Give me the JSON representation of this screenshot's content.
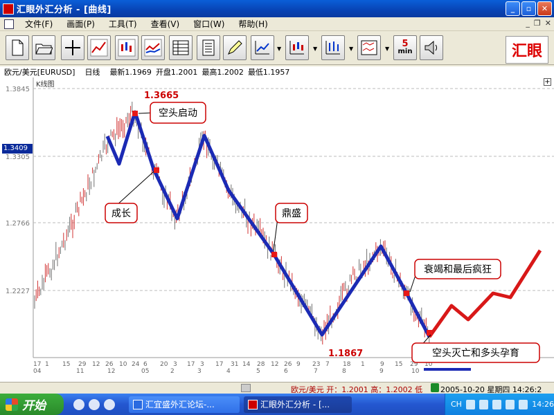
{
  "window": {
    "title": "汇眼外汇分析 - [曲线]"
  },
  "menu": [
    "文件(F)",
    "画面(P)",
    "工具(T)",
    "查看(V)",
    "窗口(W)",
    "帮助(H)"
  ],
  "toolbar": {
    "five_min_label": "5",
    "five_min_sub": "min",
    "logo_text": "汇眼"
  },
  "info": {
    "symbol": "欧元/美元[EURUSD]",
    "period": "日线",
    "latest": "最新1.1969",
    "open": "开盘1.2001",
    "high": "最高1.2002",
    "low": "最低1.1957"
  },
  "chart": {
    "panel_label": "K线图",
    "current_price": "1.3409",
    "y_ticks": [
      "1.3845",
      "1.3305",
      "1.2766",
      "1.2227"
    ],
    "x_day_ticks": [
      "17",
      "1",
      "15",
      "29",
      "12",
      "26",
      "10",
      "24",
      "6",
      "20",
      "3",
      "17",
      "3",
      "17",
      "31",
      "14",
      "28",
      "12",
      "26",
      "9",
      "23",
      "7",
      "18",
      "1",
      "9",
      "15",
      "29",
      "10"
    ],
    "x_month_ticks": [
      "04",
      "11",
      "12",
      "05",
      "2",
      "3",
      "4",
      "5",
      "6",
      "7",
      "8",
      "9",
      "10"
    ],
    "peak_label": "1.3665",
    "trough_label": "1.1867",
    "annotations": [
      "空头启动",
      "成长",
      "鼎盛",
      "衰竭和最后疯狂",
      "空头灭亡和多头孕育"
    ]
  },
  "status": {
    "quote": "欧元/美元  开：1.2001  高：1.2002  低",
    "datetime": "2005-10-20 星期四 14:26:2"
  },
  "taskbar": {
    "start": "开始",
    "tasks": [
      "汇宜盛外汇论坛-...",
      "汇眼外汇分析 - [..."
    ],
    "lang": "CH",
    "clock": "14:26"
  },
  "colors": {
    "wave": "#1b2ab4",
    "projection": "#d81818",
    "marker": "#e81818"
  }
}
